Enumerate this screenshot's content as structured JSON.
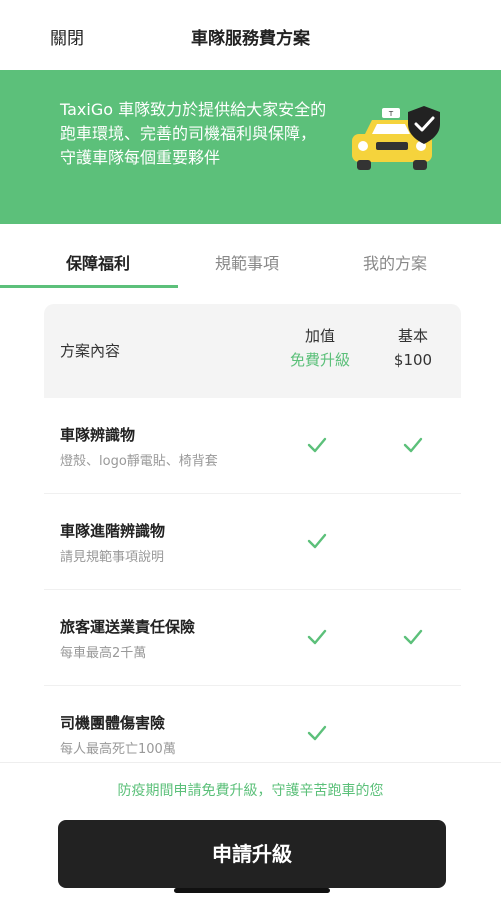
{
  "header": {
    "close_label": "關閉",
    "title": "車隊服務費方案"
  },
  "banner": {
    "text": "TaxiGo 車隊致力於提供給大家安全的跑車環境、完善的司機福利與保障，守護車隊每個重要夥伴",
    "illustration": "taxi-shield-icon",
    "accent_color": "#5cc07a"
  },
  "tabs": [
    {
      "label": "保障福利",
      "active": true
    },
    {
      "label": "規範事項",
      "active": false
    },
    {
      "label": "我的方案",
      "active": false
    }
  ],
  "table": {
    "header_label": "方案內容",
    "columns": [
      {
        "line1": "加值",
        "line2": "免費升級"
      },
      {
        "line1": "基本",
        "line2": "$100"
      }
    ],
    "rows": [
      {
        "name": "車隊辨識物",
        "sub": "燈殼、logo靜電貼、椅背套",
        "plus": true,
        "basic": true
      },
      {
        "name": "車隊進階辨識物",
        "sub": "請見規範事項說明",
        "plus": true,
        "basic": false
      },
      {
        "name": "旅客運送業責任保險",
        "sub": "每車最高2千萬",
        "plus": true,
        "basic": true
      },
      {
        "name": "司機團體傷害險",
        "sub": "每人最高死亡100萬",
        "plus": true,
        "basic": false
      }
    ]
  },
  "footer": {
    "note": "防疫期間申請免費升級，守護辛苦跑車的您",
    "cta_label": "申請升級"
  }
}
